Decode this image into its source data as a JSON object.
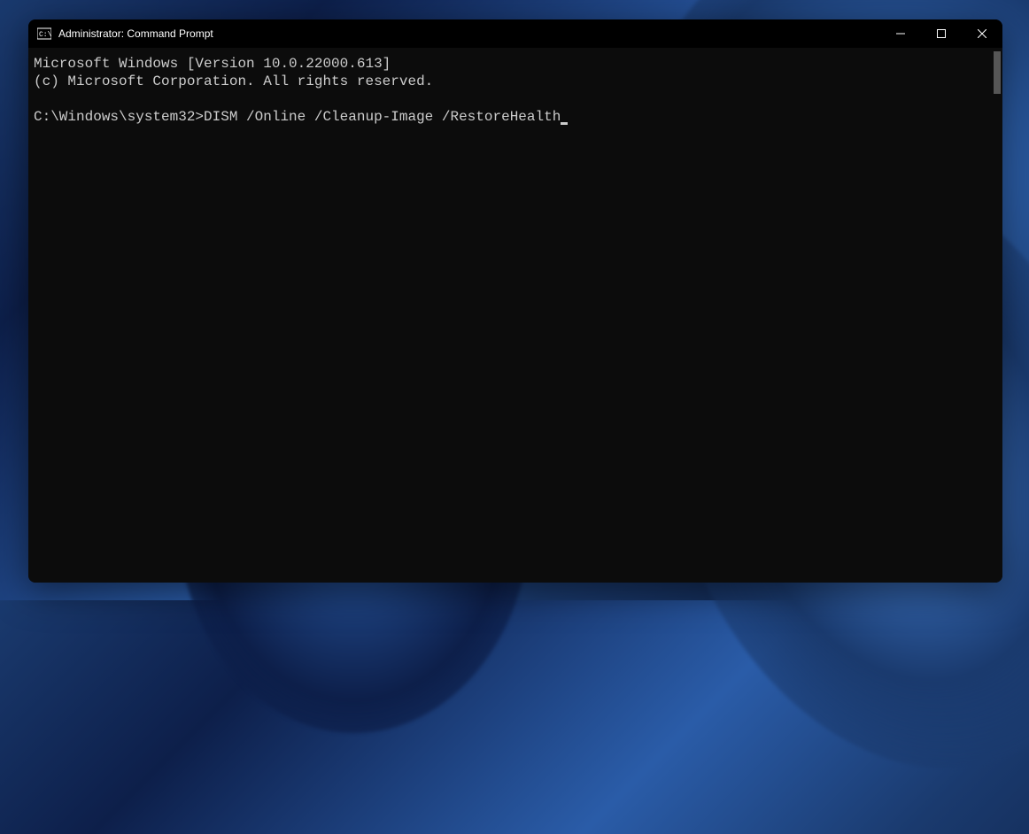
{
  "window": {
    "title": "Administrator: Command Prompt"
  },
  "terminal": {
    "line1": "Microsoft Windows [Version 10.0.22000.613]",
    "line2": "(c) Microsoft Corporation. All rights reserved.",
    "blank": "",
    "prompt": "C:\\Windows\\system32>",
    "command": "DISM /Online /Cleanup-Image /RestoreHealth"
  }
}
